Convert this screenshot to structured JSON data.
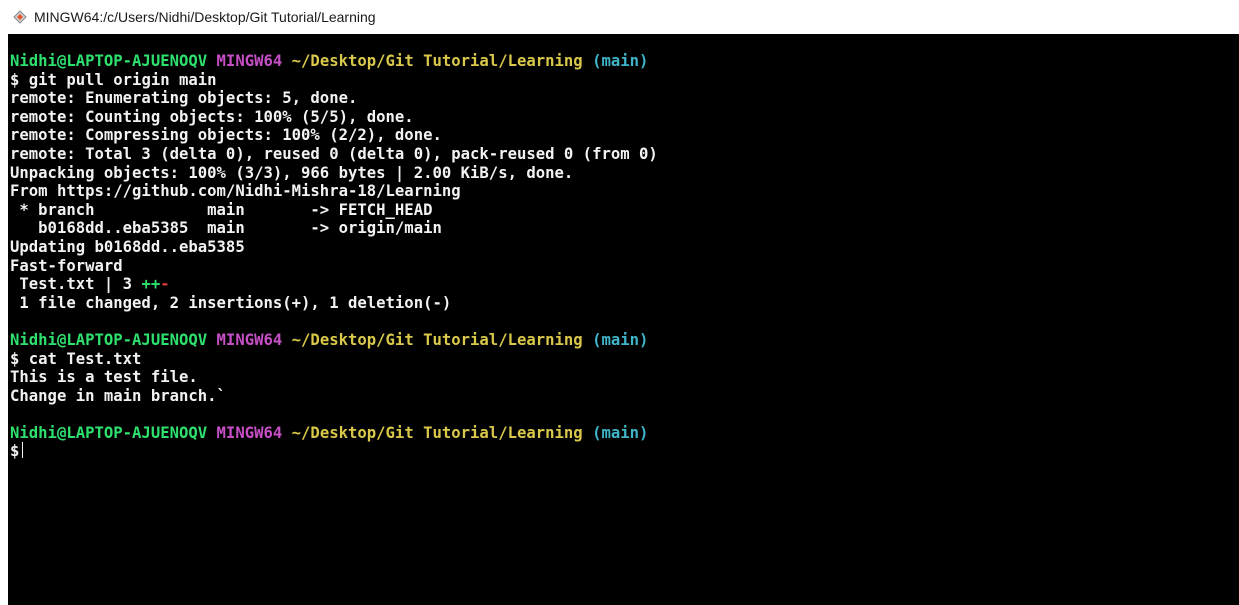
{
  "window": {
    "title": "MINGW64:/c/Users/Nidhi/Desktop/Git Tutorial/Learning",
    "icon": "git-bash-diamond-icon"
  },
  "colors": {
    "user_host": "#2ee06e",
    "system": "#c64fc6",
    "path": "#d9c84a",
    "branch": "#3fb5c9",
    "plus": "#2ee06e",
    "minus": "#e03b3b",
    "text": "#f2f2f2",
    "background": "#000000"
  },
  "terminal": {
    "prompt": {
      "user_host": "Nidhi@LAPTOP-AJUENOQV",
      "system": "MINGW64",
      "path": "~/Desktop/Git Tutorial/Learning",
      "branch": "(main)",
      "symbol": "$"
    },
    "block1": {
      "command": "git pull origin main",
      "output": [
        "remote: Enumerating objects: 5, done.",
        "remote: Counting objects: 100% (5/5), done.",
        "remote: Compressing objects: 100% (2/2), done.",
        "remote: Total 3 (delta 0), reused 0 (delta 0), pack-reused 0 (from 0)",
        "Unpacking objects: 100% (3/3), 966 bytes | 2.00 KiB/s, done.",
        "From https://github.com/Nidhi-Mishra-18/Learning",
        " * branch            main       -> FETCH_HEAD",
        "   b0168dd..eba5385  main       -> origin/main",
        "Updating b0168dd..eba5385",
        "Fast-forward"
      ],
      "diffstat": {
        "file_part": " Test.txt | 3 ",
        "plus": "++",
        "minus": "-"
      },
      "summary": " 1 file changed, 2 insertions(+), 1 deletion(-)"
    },
    "block2": {
      "command": "cat Test.txt",
      "output": [
        "This is a test file.",
        "Change in main branch.`"
      ]
    }
  }
}
